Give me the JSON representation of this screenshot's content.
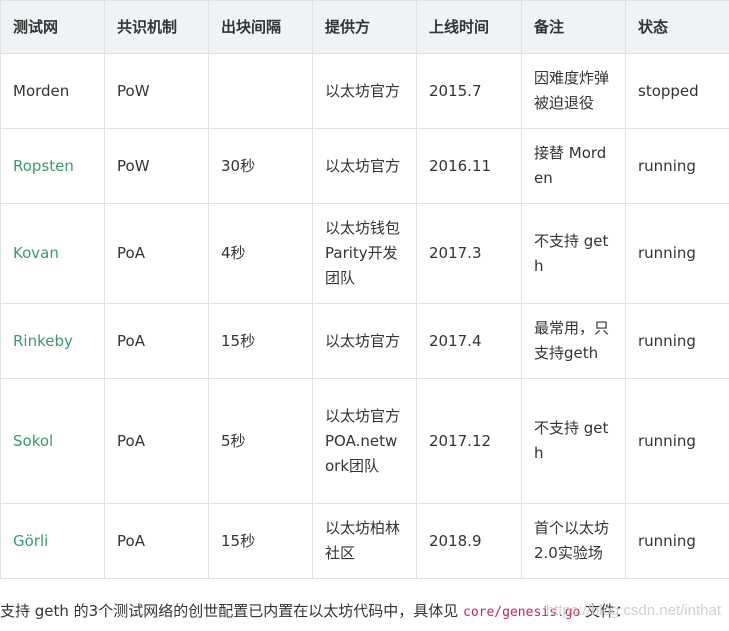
{
  "table": {
    "headers": [
      "测试网",
      "共识机制",
      "出块间隔",
      "提供方",
      "上线时间",
      "备注",
      "状态"
    ],
    "rows": [
      {
        "name": "Morden",
        "consensus": "PoW",
        "interval": "",
        "provider": "以太坊官方",
        "launch": "2015.7",
        "note": "因难度炸弹被迫退役",
        "status": "stopped"
      },
      {
        "name": "Ropsten",
        "consensus": "PoW",
        "interval": "30秒",
        "provider": "以太坊官方",
        "launch": "2016.11",
        "note": "接替 Morden",
        "status": "running"
      },
      {
        "name": "Kovan",
        "consensus": "PoA",
        "interval": "4秒",
        "provider": "以太坊钱包Parity开发团队",
        "launch": "2017.3",
        "note": "不支持 geth",
        "status": "running"
      },
      {
        "name": "Rinkeby",
        "consensus": "PoA",
        "interval": "15秒",
        "provider": "以太坊官方",
        "launch": "2017.4",
        "note": "最常用，只支持geth",
        "status": "running"
      },
      {
        "name": "Sokol",
        "consensus": "PoA",
        "interval": "5秒",
        "provider": "以太坊官方 POA.network团队",
        "launch": "2017.12",
        "note": "不支持 geth",
        "status": "running"
      },
      {
        "name": "Görli",
        "consensus": "PoA",
        "interval": "15秒",
        "provider": "以太坊柏林社区",
        "launch": "2018.9",
        "note": "首个以太坊2.0实验场",
        "status": "running"
      }
    ]
  },
  "footer": {
    "text_before": "支持 geth 的3个测试网络的创世配置已内置在以太坊代码中，具体见 ",
    "code": "core/genesis.go",
    "text_after": " 文件：",
    "watermark": "https://blog.csdn.net/inthat"
  },
  "colors": {
    "link_green": "#3a9a6e",
    "header_bg": "#eff3f5",
    "border": "#dfe2e5",
    "code": "#c7254e"
  }
}
